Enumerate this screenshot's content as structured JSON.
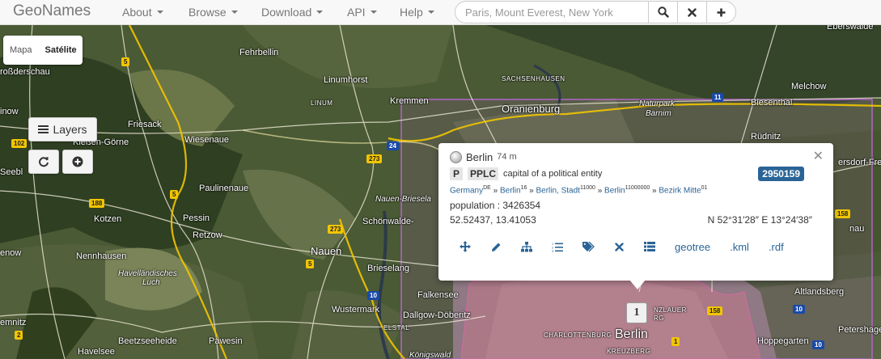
{
  "navbar": {
    "brand": "GeoNames",
    "menu": [
      {
        "label": "About"
      },
      {
        "label": "Browse"
      },
      {
        "label": "Download"
      },
      {
        "label": "API"
      },
      {
        "label": "Help"
      }
    ],
    "search_placeholder": "Paris, Mount Everest, New York"
  },
  "map": {
    "base_layers": [
      "Mapa",
      "Satélite"
    ],
    "active_layer": "Satélite",
    "layers_button": "Layers",
    "marker_count": "1",
    "labels": {
      "fehrbellin": "Fehrbellin",
      "linumhorst": "Linumhorst",
      "sachsenhausen": "SACHSENHAUSEN",
      "kremmen": "Kremmen",
      "linum": "LINUM",
      "oranienburg": "Oranienburg",
      "naturpark": "Naturpark",
      "barnim": "Barnim",
      "biesenthal": "Biesenthal",
      "melchow": "Melchow",
      "eberswalde": "Eberswalde",
      "grossderschau": "roßderschau",
      "friesack": "Friesack",
      "kleßen": "Kleßen-Görne",
      "wiesenaue": "Wiesenaue",
      "paulinenaue": "Paulinenaue",
      "kotzen": "Kotzen",
      "pessin": "Pessin",
      "retzow": "Retzow",
      "nauen_briese": "Nauen-Briesela",
      "schoenwalde": "Schönwalde-",
      "nauen": "Nauen",
      "nennhausen": "Nennhausen",
      "havellaendisches": "Havelländisches",
      "luch": "Luch",
      "brieselang": "Brieselang",
      "falkensee": "Falkensee",
      "wustermark": "Wustermark",
      "dallgow": "Dallgow-Döberitz",
      "elstal": "ELSTAL",
      "beetzsee": "Beetzseeheide",
      "paewesin": "Päwesin",
      "havelsee": "Havelsee",
      "charlottenburg": "CHARLOTTENBURG",
      "berlin": "Berlin",
      "kreuzberg": "KREUZBERG",
      "koenigswald": "Königswald",
      "lauer": "NZLAUER",
      "rg": "RG",
      "altlandsberg": "Altlandsberg",
      "petershagen": "Petershage",
      "hoppegarten": "Hoppegarten",
      "ruednitz": "Rüdnitz",
      "bersdorf": "ersdorf-Fre",
      "nau": "nau",
      "enow": "enow",
      "seebl": "Seebl",
      "emnitz": "emnitz",
      "inow": "inow"
    },
    "shields": {
      "s5a": "5",
      "s5b": "5",
      "s5c": "5",
      "s24": "24",
      "s273a": "273",
      "s273b": "273",
      "s10a": "10",
      "s10b": "10",
      "s10c": "10",
      "s11": "11",
      "s102": "102",
      "s188": "188",
      "s158a": "158",
      "s158b": "158",
      "s1": "1",
      "s2": "2"
    }
  },
  "popup": {
    "name": "Berlin",
    "elevation": "74 m",
    "feature_class": "P",
    "feature_code": "PPLC",
    "feature_desc": "capital of a political entity",
    "geonameid": "2950159",
    "hierarchy": [
      {
        "label": "Germany",
        "code": "DE"
      },
      {
        "label": "Berlin",
        "code": "16"
      },
      {
        "label": "Berlin, Stadt",
        "code": "11000"
      },
      {
        "label": "Berlin",
        "code": "11000000"
      },
      {
        "label": "Bezirk Mitte",
        "code": "01"
      }
    ],
    "population": "population : 3426354",
    "latlng": "52.52437, 13.41053",
    "dms": "N 52°31′28″ E 13°24′38″",
    "links": {
      "geotree": "geotree",
      "kml": ".kml",
      "rdf": ".rdf"
    }
  },
  "colors": {
    "link": "#2a6496",
    "id_badge": "#2a6496",
    "city_overlay": "#b264c8",
    "motorway_shield": "#f2c500",
    "federal_shield": "#1a4aa8"
  }
}
